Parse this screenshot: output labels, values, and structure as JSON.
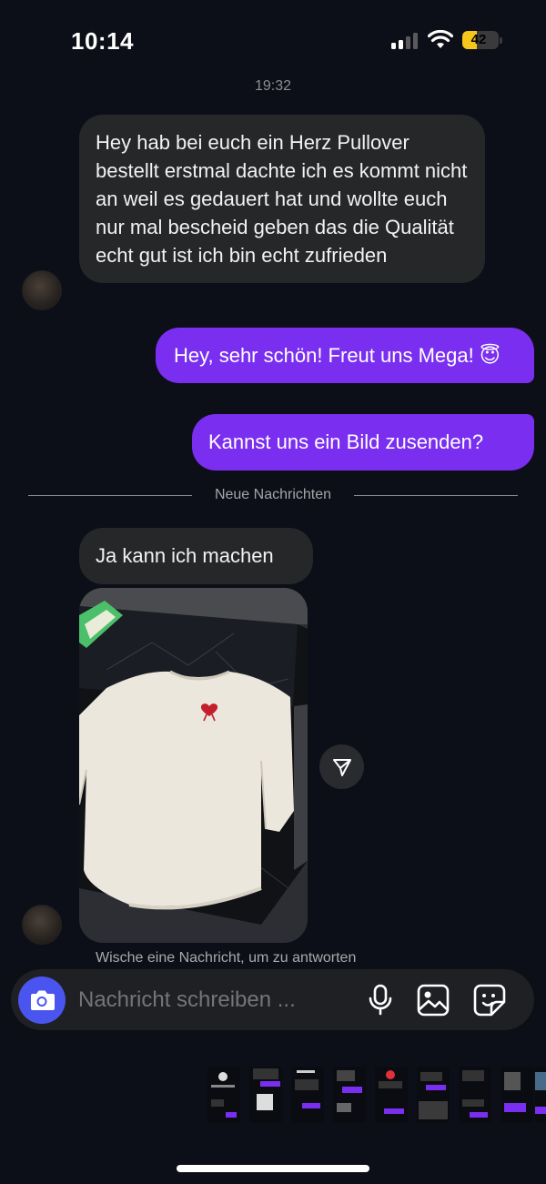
{
  "status_bar": {
    "time": "10:14",
    "battery_percent": "42",
    "signal_bars": 2,
    "icons": [
      "cellular-signal-icon",
      "wifi-icon",
      "battery-icon"
    ]
  },
  "conversation": {
    "timestamp": "19:32",
    "messages": [
      {
        "direction": "incoming",
        "text": "Hey hab bei euch ein Herz Pullover bestellt erstmal dachte ich es kommt nicht an weil es gedauert hat und wollte euch nur mal bescheid geben das die Qualität echt gut ist ich bin echt zufrieden"
      },
      {
        "direction": "outgoing",
        "text": "Hey, sehr schön! Freut uns Mega! 😇"
      },
      {
        "direction": "outgoing",
        "text": "Kannst uns ein Bild zusenden?"
      },
      {
        "direction": "incoming",
        "text": "Ja kann ich machen"
      }
    ],
    "new_messages_divider": "Neue Nachrichten",
    "photo": {
      "alt_icon": "sweater-photo"
    },
    "swipe_hint": "Wische eine Nachricht, um zu antworten"
  },
  "composer": {
    "placeholder": "Nachricht schreiben ...",
    "icons": [
      "camera-icon",
      "microphone-icon",
      "gallery-icon",
      "sticker-icon"
    ]
  },
  "colors": {
    "background": "#0c0f17",
    "incoming_bubble": "#262729",
    "outgoing_bubble": "#7a2ff0",
    "camera_button": "#4a55f0",
    "battery_fill": "#f5c71a"
  }
}
